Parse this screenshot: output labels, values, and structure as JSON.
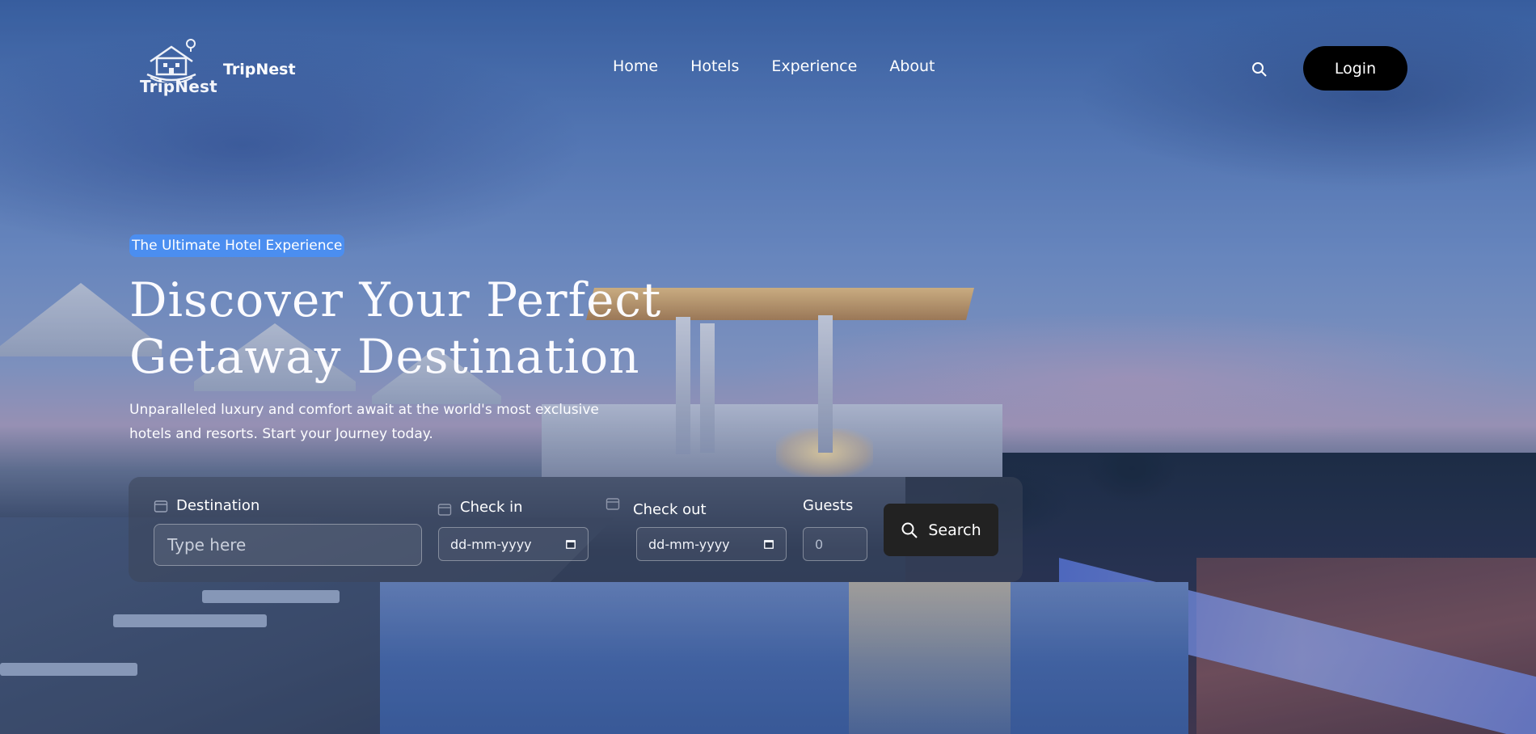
{
  "header": {
    "logo_text": "TripNest",
    "brand": "TripNest",
    "nav": [
      "Home",
      "Hotels",
      "Experience",
      "About"
    ],
    "login_label": "Login",
    "search_icon": "search-icon"
  },
  "hero": {
    "badge": "The Ultimate Hotel Experience",
    "headline_line1": "Discover Your Perfect",
    "headline_line2": "Getaway Destination",
    "subtitle_line1": "Unparalleled luxury and comfort await at the world's most exclusive",
    "subtitle_line2": "hotels and resorts. Start your Journey today."
  },
  "search": {
    "destination_label": "Destination",
    "destination_placeholder": "Type here",
    "checkin_label": "Check in",
    "checkin_value": "dd-mm-yyyy",
    "checkout_label": "Check out",
    "checkout_value": "dd-mm-yyyy",
    "guests_label": "Guests",
    "guests_value": "0",
    "button_label": "Search"
  },
  "colors": {
    "badge_bg": "#4b8ef0",
    "login_bg": "#000000",
    "search_button_bg": "#222222"
  }
}
